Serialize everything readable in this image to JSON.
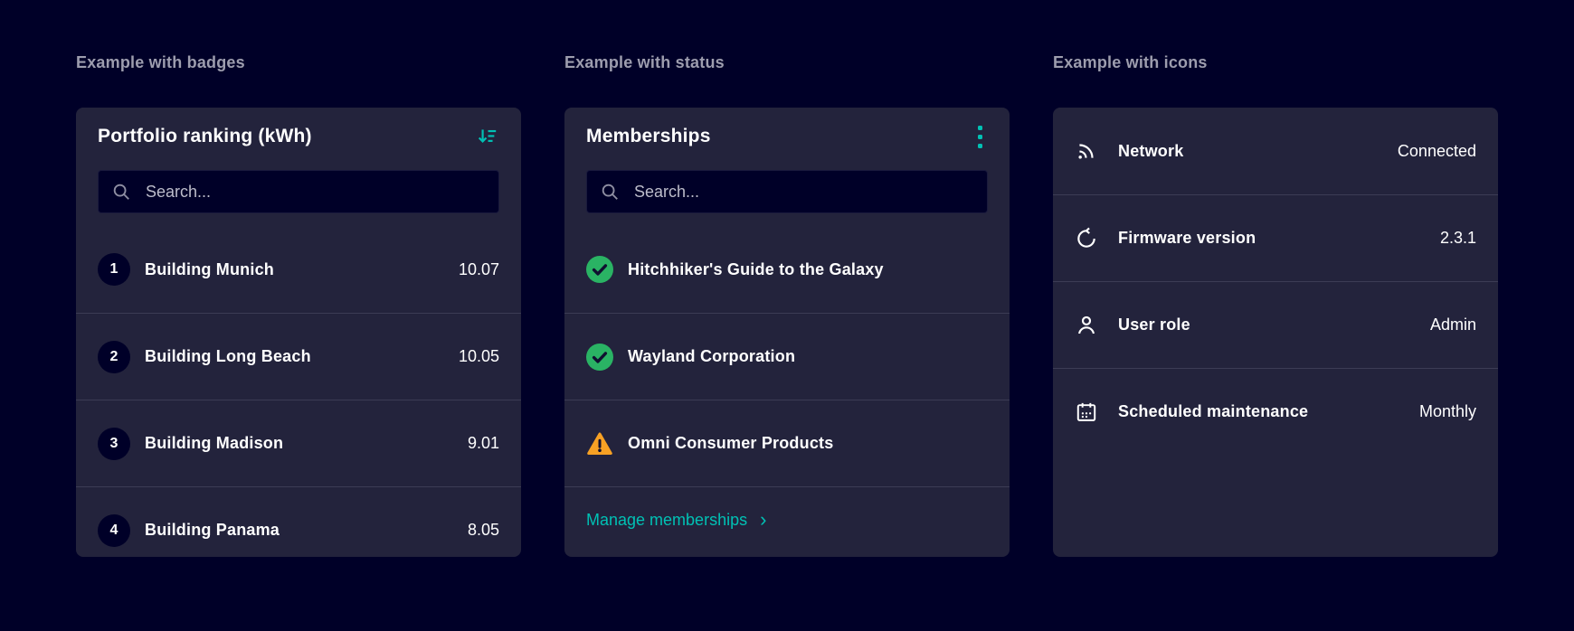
{
  "theme": {
    "background": "#000028",
    "card": "#23233c",
    "accent": "#00c1b4",
    "success": "#2ab364",
    "warning": "#f7a124"
  },
  "sections": {
    "badges": {
      "heading": "Example with badges",
      "card_title": "Portfolio ranking (kWh)",
      "sort_icon": "sort-descending-icon",
      "search": {
        "placeholder": "Search...",
        "value": ""
      },
      "items": [
        {
          "rank": "1",
          "name": "Building Munich",
          "value": "10.07"
        },
        {
          "rank": "2",
          "name": "Building Long Beach",
          "value": "10.05"
        },
        {
          "rank": "3",
          "name": "Building Madison",
          "value": "9.01"
        },
        {
          "rank": "4",
          "name": "Building Panama",
          "value": "8.05"
        }
      ]
    },
    "status": {
      "heading": "Example with status",
      "card_title": "Memberships",
      "menu_icon": "kebab-menu-icon",
      "search": {
        "placeholder": "Search...",
        "value": ""
      },
      "items": [
        {
          "status": "success",
          "status_icon": "check-circle-icon",
          "name": "Hitchhiker's Guide to the Galaxy"
        },
        {
          "status": "success",
          "status_icon": "check-circle-icon",
          "name": "Wayland Corporation"
        },
        {
          "status": "warning",
          "status_icon": "warning-triangle-icon",
          "name": "Omni Consumer Products"
        }
      ],
      "link": {
        "label": "Manage memberships",
        "chevron": "›"
      }
    },
    "icons": {
      "heading": "Example with icons",
      "rows": [
        {
          "icon": "network-icon",
          "label": "Network",
          "value": "Connected"
        },
        {
          "icon": "firmware-refresh-icon",
          "label": "Firmware version",
          "value": "2.3.1"
        },
        {
          "icon": "user-icon",
          "label": "User role",
          "value": "Admin"
        },
        {
          "icon": "calendar-icon",
          "label": "Scheduled maintenance",
          "value": "Monthly"
        }
      ]
    }
  }
}
